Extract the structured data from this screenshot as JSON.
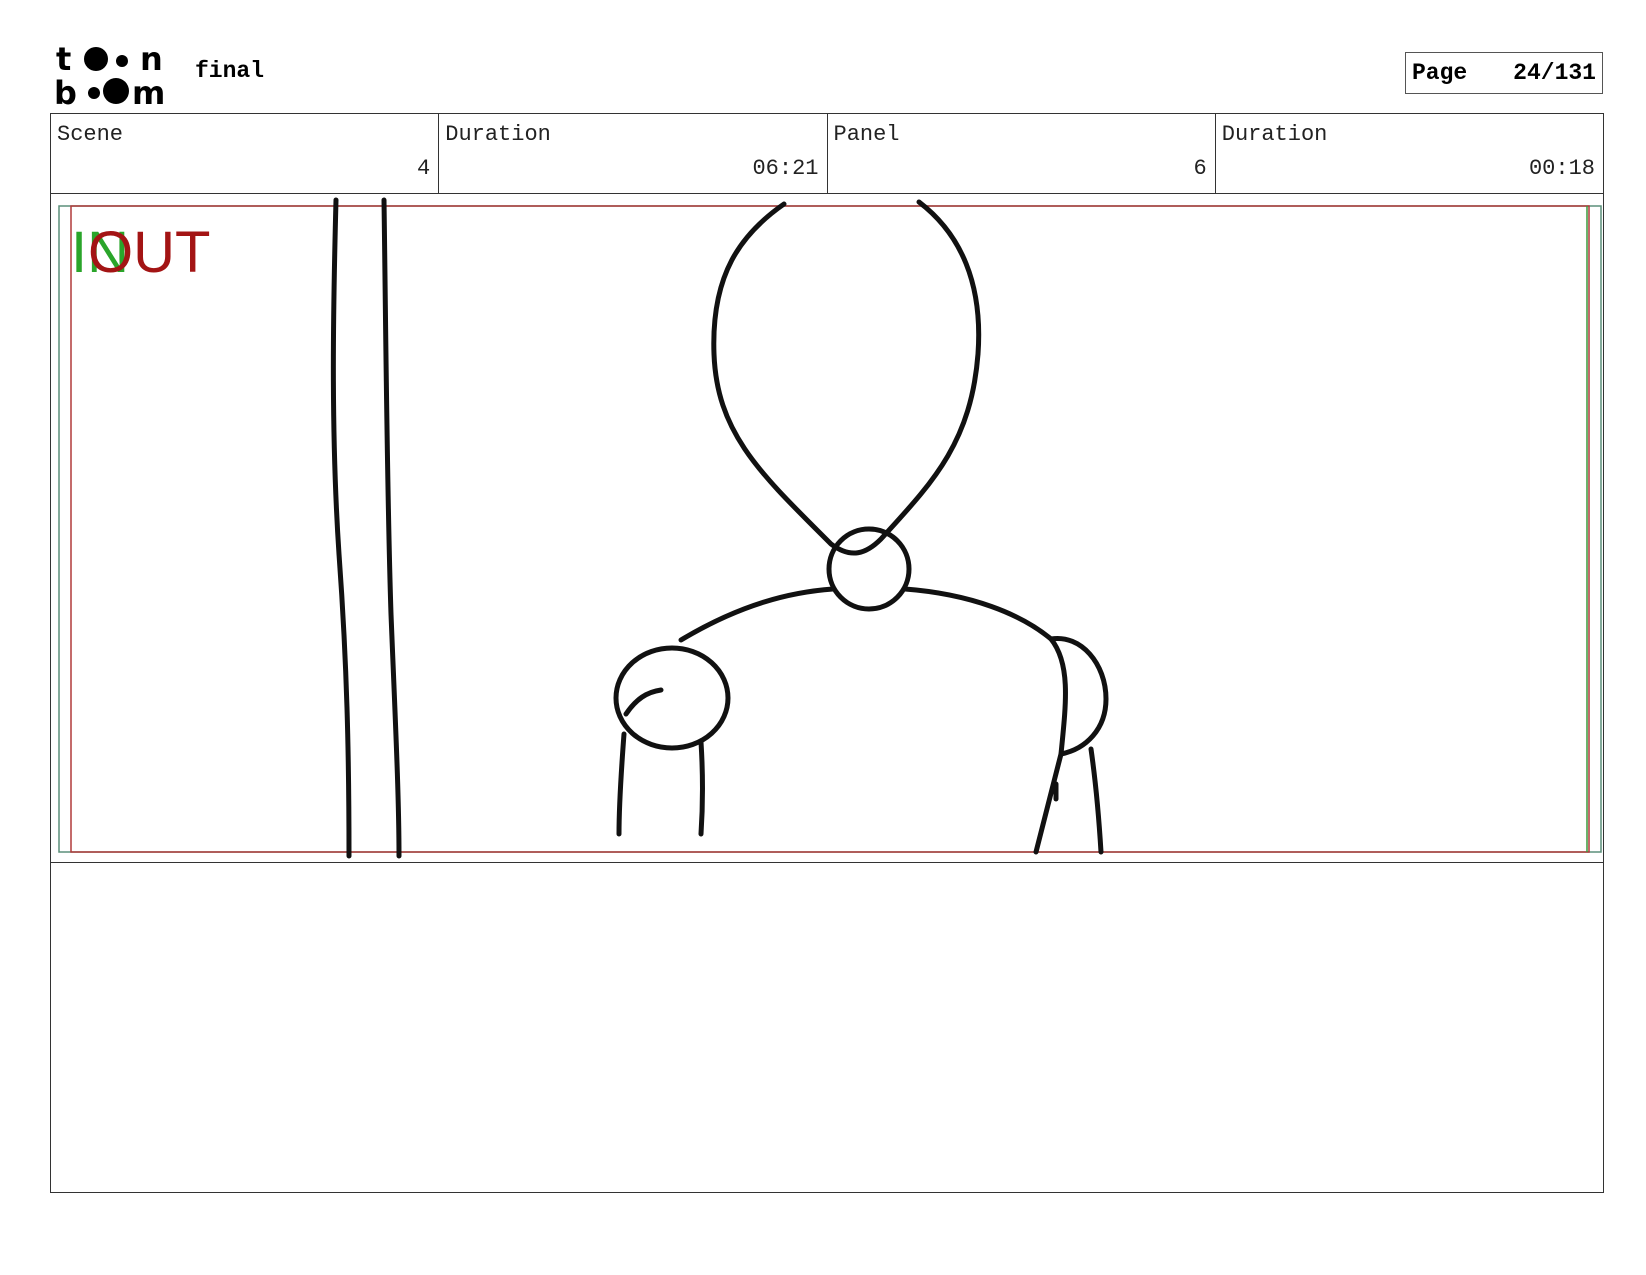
{
  "header": {
    "logo_text": "toonboom",
    "project_title": "final",
    "page_label": "Page",
    "page_value": "24/131"
  },
  "info": [
    {
      "label": "Scene",
      "value": "4"
    },
    {
      "label": "Duration",
      "value": "06:21"
    },
    {
      "label": "Panel",
      "value": "6"
    },
    {
      "label": "Duration",
      "value": "00:18"
    }
  ],
  "panel": {
    "in_marker": "IN",
    "out_marker": "OUT",
    "in_color": "#2aa52a",
    "out_color": "#a31414"
  },
  "notes": {
    "text": ""
  }
}
